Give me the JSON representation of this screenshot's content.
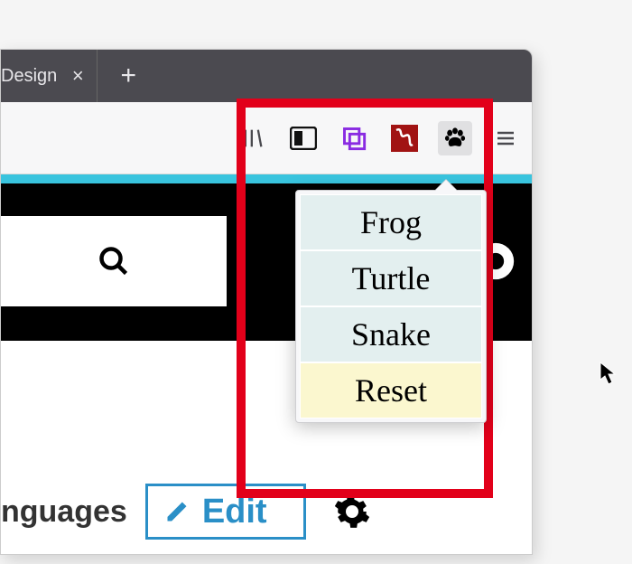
{
  "tab": {
    "title": "Design",
    "close_glyph": "×",
    "new_glyph": "+"
  },
  "toolbar": {
    "icons": [
      "library",
      "reader",
      "copy",
      "pdf",
      "paw",
      "menu"
    ]
  },
  "popup": {
    "items": [
      "Frog",
      "Turtle",
      "Snake"
    ],
    "reset": "Reset"
  },
  "page": {
    "languages_label": "nguages",
    "edit_label": "Edit"
  }
}
